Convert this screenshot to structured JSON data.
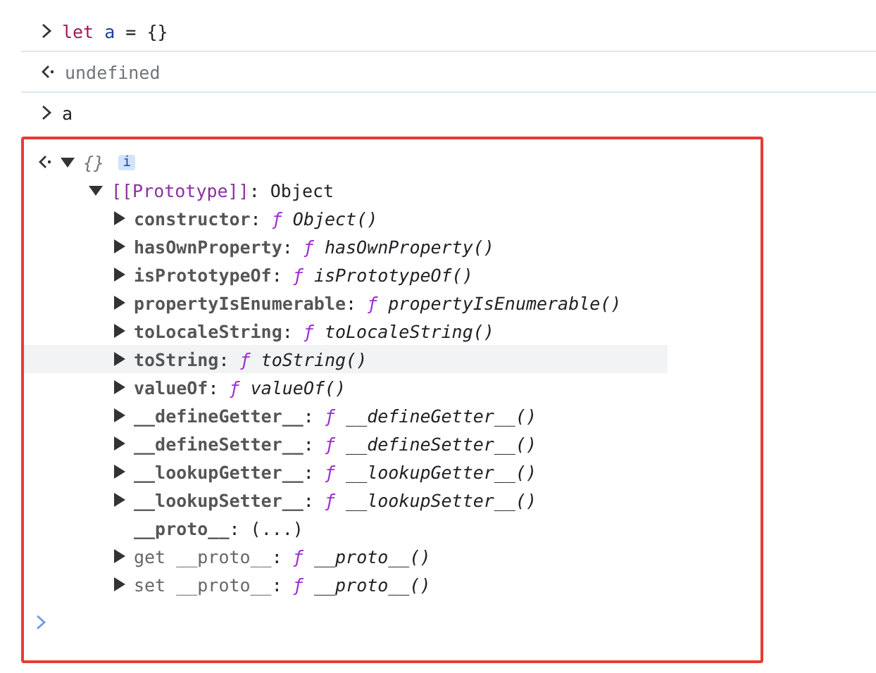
{
  "console": [
    {
      "kind": "input",
      "code": [
        {
          "kind": "keyword",
          "s": "let"
        },
        {
          "kind": "variable",
          "s": "a"
        },
        {
          "kind": "plain",
          "s": "= {}"
        }
      ]
    },
    {
      "kind": "output",
      "code": [
        {
          "kind": "undefined",
          "s": "undefined"
        }
      ]
    },
    {
      "kind": "input",
      "code": [
        {
          "kind": "plain",
          "s": "a"
        }
      ]
    }
  ],
  "result": {
    "highlighted": true,
    "summary": "{}",
    "info_badge": "i",
    "expanded": true,
    "prototype": {
      "label": "[[Prototype]]",
      "sep": ":",
      "value": "Object",
      "expanded": true,
      "properties": [
        {
          "kind": "method",
          "key": "constructor",
          "sep": ":",
          "sign": "ƒ",
          "value": "Object()",
          "expanded": false,
          "selected": false
        },
        {
          "kind": "method",
          "key": "hasOwnProperty",
          "sep": ":",
          "sign": "ƒ",
          "value": "hasOwnProperty()",
          "expanded": false,
          "selected": false
        },
        {
          "kind": "method",
          "key": "isPrototypeOf",
          "sep": ":",
          "sign": "ƒ",
          "value": "isPrototypeOf()",
          "expanded": false,
          "selected": false
        },
        {
          "kind": "method",
          "key": "propertyIsEnumerable",
          "sep": ":",
          "sign": "ƒ",
          "value": "propertyIsEnumerable()",
          "expanded": false,
          "selected": false
        },
        {
          "kind": "method",
          "key": "toLocaleString",
          "sep": ":",
          "sign": "ƒ",
          "value": "toLocaleString()",
          "expanded": false,
          "selected": false
        },
        {
          "kind": "method",
          "key": "toString",
          "sep": ":",
          "sign": "ƒ",
          "value": "toString()",
          "expanded": false,
          "selected": true
        },
        {
          "kind": "method",
          "key": "valueOf",
          "sep": ":",
          "sign": "ƒ",
          "value": "valueOf()",
          "expanded": false,
          "selected": false
        },
        {
          "kind": "method",
          "key": "__defineGetter__",
          "sep": ":",
          "sign": "ƒ",
          "value": "__defineGetter__()",
          "expanded": false,
          "selected": false
        },
        {
          "kind": "method",
          "key": "__defineSetter__",
          "sep": ":",
          "sign": "ƒ",
          "value": "__defineSetter__()",
          "expanded": false,
          "selected": false
        },
        {
          "kind": "method",
          "key": "__lookupGetter__",
          "sep": ":",
          "sign": "ƒ",
          "value": "__lookupGetter__()",
          "expanded": false,
          "selected": false
        },
        {
          "kind": "method",
          "key": "__lookupSetter__",
          "sep": ":",
          "sign": "ƒ",
          "value": "__lookupSetter__()",
          "expanded": false,
          "selected": false
        },
        {
          "kind": "lazy",
          "key": "__proto__",
          "sep": ":",
          "value": "(...)"
        },
        {
          "kind": "accessor",
          "key": "get __proto__",
          "sep": ":",
          "sign": "ƒ",
          "value": "__proto__()",
          "expanded": false,
          "selected": false
        },
        {
          "kind": "accessor",
          "key": "set __proto__",
          "sep": ":",
          "sign": "ƒ",
          "value": "__proto__()",
          "expanded": false,
          "selected": false
        }
      ]
    }
  }
}
